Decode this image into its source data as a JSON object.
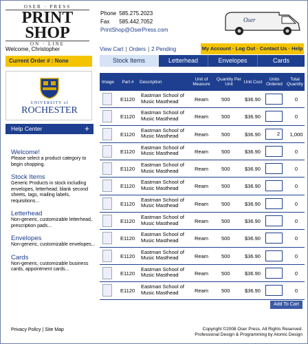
{
  "logo": {
    "top": "OSER · PRESS",
    "main": "PRINT SHOP",
    "bottom": "ON · LINE"
  },
  "contact": {
    "phone_label": "Phone",
    "phone": "585.275.2023",
    "fax_label": "Fax",
    "fax": "585.442.7052",
    "email": "PrintShop@OserPress.com"
  },
  "welcome": "Welcome, Christopher",
  "topnav": {
    "view_cart": "View Cart",
    "orders": "Orders",
    "pending": "2 Pending"
  },
  "account_bar": "My Account · Log Out · Contact Us · Help",
  "current_order": "Current Order # : None",
  "logo_ur": {
    "line1": "UNIVERSITY of",
    "line2": "ROCHESTER"
  },
  "help": {
    "label": "Help Center",
    "icon": "+"
  },
  "sidebar": [
    {
      "heading": "Welcome!",
      "text": "Please select a product category to begin shopping."
    },
    {
      "heading": "Stock Items",
      "text": "Generic Products in stock including envelopes, letterhead, blank second sheets, tags, mailing labels, requisitions..."
    },
    {
      "heading": "Letterhead",
      "text": "Non-generic, customizable letterhead, prescription pads..."
    },
    {
      "heading": "Envelopes",
      "text": "Non-generic, customizable envelopes..."
    },
    {
      "heading": "Cards",
      "text": "Non-generic, customizable business cards, appointment cards..."
    }
  ],
  "tabs": [
    "Stock Items",
    "Letterhead",
    "Envelopes",
    "Cards"
  ],
  "columns": [
    "Image",
    "Part #",
    "Description",
    "Unit of Measure",
    "Quantity Per Unit",
    "Unit Cost",
    "Units Ordered",
    "Total Quantity"
  ],
  "rows": [
    {
      "part": "E1120",
      "desc": "Eastman School of Music Masthead",
      "unit": "Ream",
      "qty": "500",
      "cost": "$36.90",
      "ordered": "",
      "total": "0"
    },
    {
      "part": "E1120",
      "desc": "Eastman School of Music Masthead",
      "unit": "Ream",
      "qty": "500",
      "cost": "$36.90",
      "ordered": "",
      "total": "0"
    },
    {
      "part": "E1120",
      "desc": "Eastman School of Music Masthead",
      "unit": "Ream",
      "qty": "500",
      "cost": "$36.90",
      "ordered": "2",
      "total": "1,000"
    },
    {
      "part": "E1120",
      "desc": "Eastman School of Music Masthead",
      "unit": "Ream",
      "qty": "500",
      "cost": "$36.90",
      "ordered": "",
      "total": "0"
    },
    {
      "part": "E1120",
      "desc": "Eastman School of Music Masthead",
      "unit": "Ream",
      "qty": "500",
      "cost": "$36.90",
      "ordered": "",
      "total": "0"
    },
    {
      "part": "E1120",
      "desc": "Eastman School of Music Masthead",
      "unit": "Ream",
      "qty": "500",
      "cost": "$36.90",
      "ordered": "",
      "total": "0"
    },
    {
      "part": "E1120",
      "desc": "Eastman School of Music Masthead",
      "unit": "Ream",
      "qty": "500",
      "cost": "$36.90",
      "ordered": "",
      "total": "0"
    },
    {
      "part": "E1120",
      "desc": "Eastman School of Music Masthead",
      "unit": "Ream",
      "qty": "500",
      "cost": "$36.90",
      "ordered": "",
      "total": "0"
    },
    {
      "part": "E1120",
      "desc": "Eastman School of Music Masthead",
      "unit": "Ream",
      "qty": "500",
      "cost": "$36.90",
      "ordered": "",
      "total": "0"
    },
    {
      "part": "E1120",
      "desc": "Eastman School of Music Masthead",
      "unit": "Ream",
      "qty": "500",
      "cost": "$36.90",
      "ordered": "",
      "total": "0"
    },
    {
      "part": "E1120",
      "desc": "Eastman School of Music Masthead",
      "unit": "Ream",
      "qty": "500",
      "cost": "$36.90",
      "ordered": "",
      "total": "0"
    },
    {
      "part": "E1120",
      "desc": "Eastman School of Music Masthead",
      "unit": "Ream",
      "qty": "500",
      "cost": "$36.90",
      "ordered": "",
      "total": "0"
    }
  ],
  "add_to_cart": "Add To Cart",
  "footer": {
    "left": "Privacy Policy | Site Map",
    "right1": "Copyright ©2008 Oser Press. All Rights Reserved.",
    "right2": "Professional Design & Programming by Atomic Design"
  },
  "colors": {
    "navy": "#1e3f8f",
    "yellow": "#f5c400"
  }
}
